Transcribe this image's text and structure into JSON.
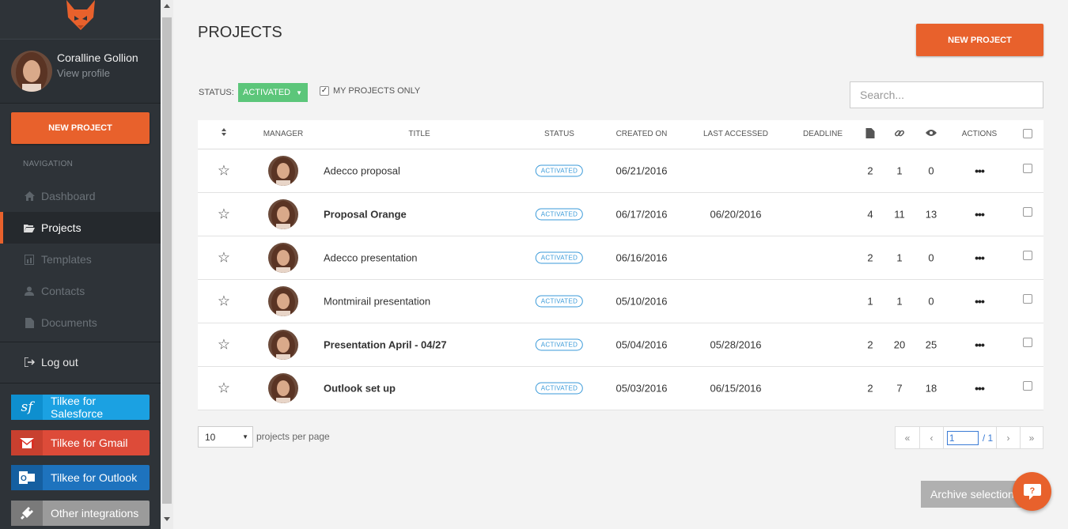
{
  "sidebar": {
    "user_name": "Coralline Gollion",
    "profile_link": "View profile",
    "new_project": "NEW PROJECT",
    "nav_title": "NAVIGATION",
    "nav": [
      {
        "label": "Dashboard",
        "icon": "home-icon"
      },
      {
        "label": "Projects",
        "icon": "folder-open-icon",
        "active": true
      },
      {
        "label": "Templates",
        "icon": "template-icon"
      },
      {
        "label": "Contacts",
        "icon": "user-icon"
      },
      {
        "label": "Documents",
        "icon": "document-icon"
      }
    ],
    "logout": "Log out",
    "integrations": [
      {
        "label": "Tilkee for Salesforce",
        "color": "#1ba1e2",
        "icon_color": "#0e8fcf"
      },
      {
        "label": "Tilkee for Gmail",
        "color": "#dd4b39",
        "icon_color": "#c8402f"
      },
      {
        "label": "Tilkee for Outlook",
        "color": "#1e73be",
        "icon_color": "#155fa0"
      },
      {
        "label": "Other integrations",
        "color": "#9b9b9b",
        "icon_color": "#7a7a7a"
      }
    ]
  },
  "header": {
    "title": "PROJECTS",
    "new_project": "NEW PROJECT"
  },
  "filters": {
    "status_label": "STATUS:",
    "status_value": "ACTIVATED",
    "my_projects_label": "MY PROJECTS ONLY",
    "my_projects_checked": true,
    "search_placeholder": "Search..."
  },
  "table": {
    "columns": [
      "MANAGER",
      "TITLE",
      "STATUS",
      "CREATED ON",
      "LAST ACCESSED",
      "DEADLINE",
      "ACTIONS"
    ],
    "rows": [
      {
        "title": "Adecco proposal",
        "bold": false,
        "status": "ACTIVATED",
        "created": "06/21/2016",
        "accessed": "",
        "deadline": "",
        "docs": "2",
        "links": "1",
        "views": "0"
      },
      {
        "title": "Proposal Orange",
        "bold": true,
        "status": "ACTIVATED",
        "created": "06/17/2016",
        "accessed": "06/20/2016",
        "deadline": "",
        "docs": "4",
        "links": "11",
        "views": "13"
      },
      {
        "title": "Adecco presentation",
        "bold": false,
        "status": "ACTIVATED",
        "created": "06/16/2016",
        "accessed": "",
        "deadline": "",
        "docs": "2",
        "links": "1",
        "views": "0"
      },
      {
        "title": "Montmirail presentation",
        "bold": false,
        "status": "ACTIVATED",
        "created": "05/10/2016",
        "accessed": "",
        "deadline": "",
        "docs": "1",
        "links": "1",
        "views": "0"
      },
      {
        "title": "Presentation April - 04/27",
        "bold": true,
        "status": "ACTIVATED",
        "created": "05/04/2016",
        "accessed": "05/28/2016",
        "deadline": "",
        "docs": "2",
        "links": "20",
        "views": "25"
      },
      {
        "title": "Outlook set up",
        "bold": true,
        "status": "ACTIVATED",
        "created": "05/03/2016",
        "accessed": "06/15/2016",
        "deadline": "",
        "docs": "2",
        "links": "7",
        "views": "18"
      }
    ]
  },
  "footer": {
    "per_page_value": "10",
    "per_page_label": "projects per page",
    "pager": {
      "first": "«",
      "prev": "‹",
      "current": "1",
      "total": "/ 1",
      "next": "›",
      "last": "»"
    },
    "archive": "Archive selection"
  },
  "colors": {
    "accent": "#e8612c",
    "status_green": "#5cc67a",
    "badge_blue": "#3a9ad9"
  }
}
